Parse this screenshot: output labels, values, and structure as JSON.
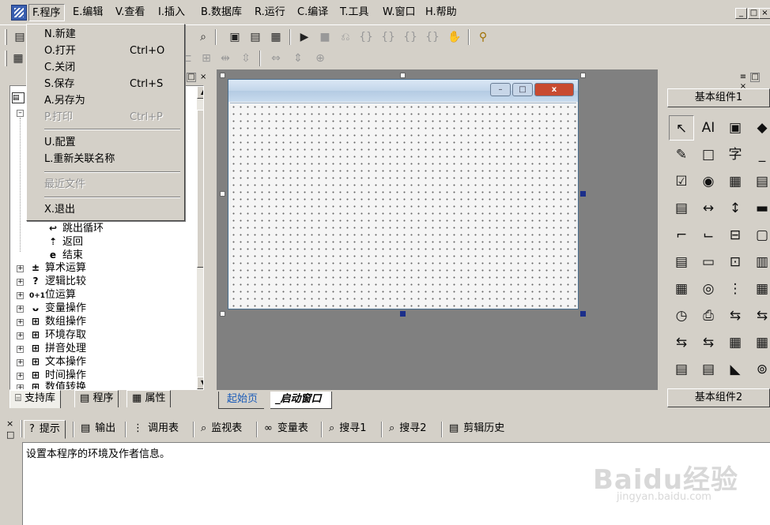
{
  "menubar": {
    "items": [
      {
        "label": "F.程序"
      },
      {
        "label": "E.编辑"
      },
      {
        "label": "V.查看"
      },
      {
        "label": "I.插入"
      },
      {
        "label": "B.数据库"
      },
      {
        "label": "R.运行"
      },
      {
        "label": "C.编译"
      },
      {
        "label": "T.工具"
      },
      {
        "label": "W.窗口"
      },
      {
        "label": "H.帮助"
      }
    ],
    "mdi_buttons": [
      "_",
      "□",
      "×"
    ]
  },
  "program_menu": {
    "items": [
      {
        "label": "N.新建",
        "shortcut": ""
      },
      {
        "label": "O.打开",
        "shortcut": "Ctrl+O"
      },
      {
        "label": "C.关闭",
        "shortcut": ""
      },
      {
        "label": "S.保存",
        "shortcut": "Ctrl+S"
      },
      {
        "label": "A.另存为",
        "shortcut": ""
      },
      {
        "label": "P.打印",
        "shortcut": "Ctrl+P"
      },
      {
        "label": "U.配置",
        "shortcut": ""
      },
      {
        "label": "L.重新关联名称",
        "shortcut": ""
      },
      {
        "label": "最近文件",
        "shortcut": ""
      },
      {
        "label": "X.退出",
        "shortcut": ""
      }
    ]
  },
  "tree": {
    "items": [
      {
        "label": "跳出循环",
        "icon": "↩"
      },
      {
        "label": "返回",
        "icon": "⇡"
      },
      {
        "label": "结束",
        "icon": "e"
      },
      {
        "label": "算术运算",
        "icon": "±"
      },
      {
        "label": "逻辑比较",
        "icon": "?"
      },
      {
        "label": "位运算",
        "icon": "0+1"
      },
      {
        "label": "变量操作",
        "icon": "ᴗ"
      },
      {
        "label": "数组操作",
        "icon": "⊞"
      },
      {
        "label": "环境存取",
        "icon": "⊞"
      },
      {
        "label": "拼音处理",
        "icon": "⊞"
      },
      {
        "label": "文本操作",
        "icon": "⊞"
      },
      {
        "label": "时间操作",
        "icon": "⊞"
      },
      {
        "label": "数值转换",
        "icon": "⊞"
      }
    ]
  },
  "left_tabs": [
    {
      "label": "支持库"
    },
    {
      "label": "程序"
    },
    {
      "label": "属性"
    }
  ],
  "designer_tabs": [
    {
      "label": "起始页"
    },
    {
      "label": "_启动窗口"
    }
  ],
  "form_caption_buttons": [
    "–",
    "□",
    "x"
  ],
  "right_panel": {
    "group1": "基本组件1",
    "group2": "基本组件2",
    "components": [
      "↖",
      "AI",
      "▣",
      "◆",
      "✎",
      "□",
      "字",
      "_",
      "☑",
      "◉",
      "▦",
      "▤",
      "▤",
      "↔",
      "↕",
      "▬",
      "⌐",
      "⌙",
      "⊟",
      "▢",
      "▤",
      "▭",
      "⊡",
      "▥",
      "▦",
      "◎",
      "⋮",
      "▦",
      "◷",
      "⎙",
      "⇆",
      "⇆",
      "⇆",
      "⇆",
      "▦",
      "▦",
      "▤",
      "▤",
      "◣",
      "⊚"
    ]
  },
  "bottom_tabs": [
    {
      "label": "提示",
      "icon": "?"
    },
    {
      "label": "输出",
      "icon": "▤"
    },
    {
      "label": "调用表",
      "icon": "⋮"
    },
    {
      "label": "监视表",
      "icon": "⌕"
    },
    {
      "label": "变量表",
      "icon": "∞"
    },
    {
      "label": "搜寻1",
      "icon": "⌕"
    },
    {
      "label": "搜寻2",
      "icon": "⌕"
    },
    {
      "label": "剪辑历史",
      "icon": "▤"
    }
  ],
  "output": {
    "text": "设置本程序的环境及作者信息。"
  },
  "watermark": {
    "main": "Baidu经验",
    "sub": "jingyan.baidu.com"
  }
}
